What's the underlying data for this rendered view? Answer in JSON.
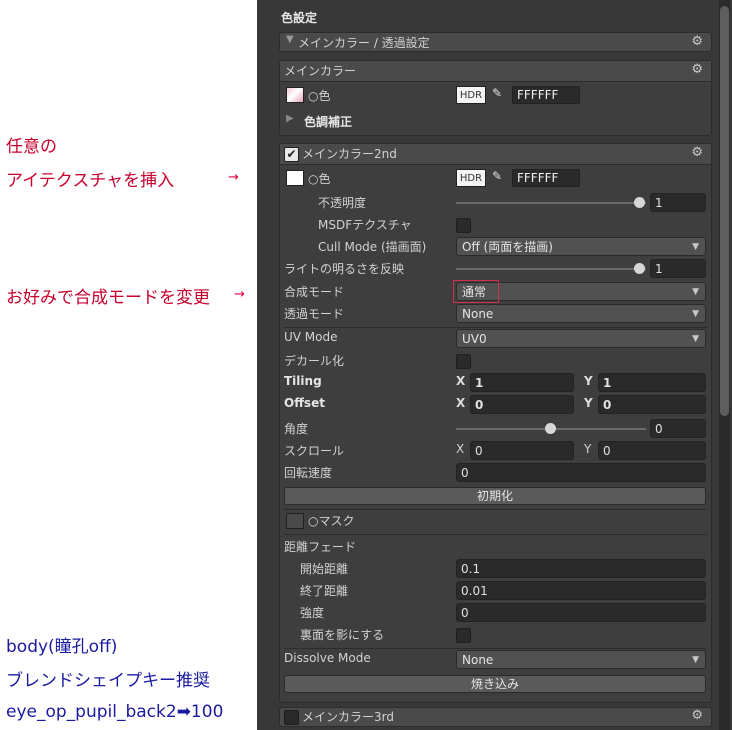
{
  "annotations": {
    "note1_line1": "任意の",
    "note1_line2": "アイテクスチャを挿入",
    "note2": "お好みで合成モードを変更",
    "arrow": "→",
    "note3_line1": "body(瞳孔off)",
    "note3_line2": "ブレンドシェイプキー推奨",
    "note3_line3": "eye_op_pupil_back2➡100"
  },
  "inspector": {
    "color_settings_title": "色設定",
    "main_color_transparency": "メインカラー / 透過設定",
    "main_color": {
      "header": "メインカラー",
      "color_label": "○色",
      "hdr": "HDR",
      "hex": "FFFFFF",
      "color_adjust": "色調補正"
    },
    "main_color_2nd": {
      "header": "メインカラー2nd",
      "color_label": "○色",
      "hdr": "HDR",
      "hex": "FFFFFF",
      "opacity_label": "不透明度",
      "opacity_value": "1",
      "msdf_label": "MSDFテクスチャ",
      "cull_label": "Cull Mode (描画面)",
      "cull_value": "Off (両面を描画)",
      "light_label": "ライトの明るさを反映",
      "light_value": "1",
      "blend_label": "合成モード",
      "blend_value": "通常",
      "alpha_label": "透過モード",
      "alpha_value": "None",
      "uv_label": "UV Mode",
      "uv_value": "UV0",
      "decal_label": "デカール化",
      "tiling_label": "Tiling",
      "tiling_x": "1",
      "tiling_y": "1",
      "offset_label": "Offset",
      "offset_x": "0",
      "offset_y": "0",
      "angle_label": "角度",
      "angle_value": "0",
      "scroll_label": "スクロール",
      "scroll_x": "0",
      "scroll_y": "0",
      "rotation_label": "回転速度",
      "rotation_value": "0",
      "reset_button": "初期化",
      "mask_label": "○マスク",
      "distance_fade_label": "距離フェード",
      "fade_start_label": "開始距離",
      "fade_start_value": "0.1",
      "fade_end_label": "終了距離",
      "fade_end_value": "0.01",
      "strength_label": "強度",
      "strength_value": "0",
      "backface_label": "裏面を影にする",
      "dissolve_label": "Dissolve Mode",
      "dissolve_value": "None",
      "bake_button": "焼き込み",
      "axis_x": "X",
      "axis_y": "Y"
    },
    "main_color_3rd": {
      "header": "メインカラー3rd"
    }
  },
  "colors": {
    "panel_bg": "#383838",
    "annotation_red": "#c8002c",
    "annotation_blue": "#1a1aa0"
  }
}
